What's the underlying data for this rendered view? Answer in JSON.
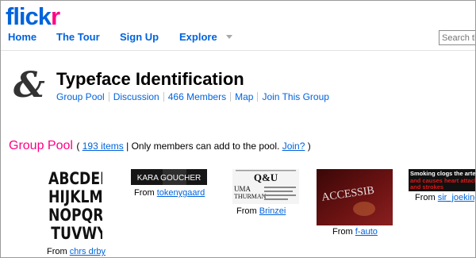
{
  "logo": {
    "part1": "flick",
    "part2": "r"
  },
  "nav": {
    "items": [
      "Home",
      "The Tour",
      "Sign Up",
      "Explore"
    ],
    "search_placeholder": "Search th"
  },
  "group": {
    "title": "Typeface Identification",
    "links": [
      "Group Pool",
      "Discussion",
      "466 Members",
      "Map",
      "Join This Group"
    ]
  },
  "pool": {
    "title": "Group Pool",
    "open": "(",
    "items_link": "193 items",
    "pipe": "|",
    "members_text": "Only members can add to the pool.",
    "join_link": "Join?",
    "close": ")"
  },
  "thumbnails": [
    {
      "from": "From",
      "user": "chrs drby",
      "image_text": [
        "ABCDEF",
        "HIJKLM",
        "NOPQRS",
        "TUVWY"
      ]
    },
    {
      "from": "From",
      "user": "tokenygaard",
      "image_text": [
        "KARA GOUCHER"
      ]
    },
    {
      "from": "From",
      "user": "Brinzei",
      "image_text": [
        "Q&U",
        "UMA",
        "THURMAN"
      ]
    },
    {
      "from": "From",
      "user": "f-auto",
      "image_text": [
        "ACCESSIB"
      ]
    },
    {
      "from": "From",
      "user": "sir_joeking",
      "image_text": [
        "Smoking clogs the arter",
        "and causes heart attack",
        "and strokes"
      ]
    }
  ],
  "colors": {
    "brand_blue": "#0063dc",
    "brand_pink": "#ff0084"
  }
}
